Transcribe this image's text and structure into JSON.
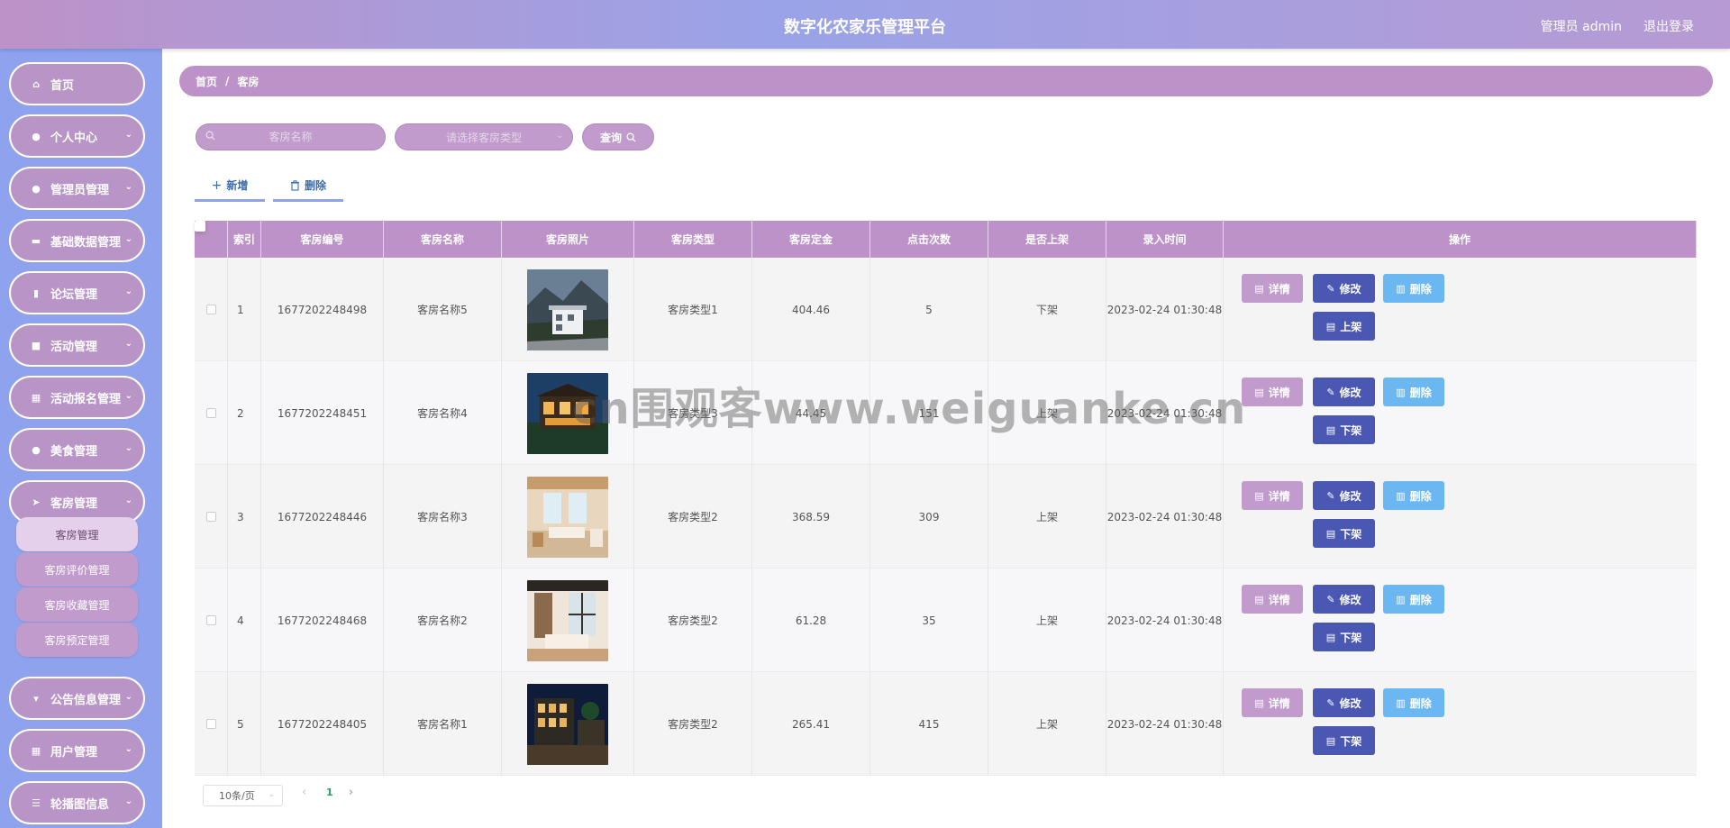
{
  "app": {
    "title": "数字化农家乐管理平台",
    "user_label": "管理员 admin",
    "logout_label": "退出登录"
  },
  "sidebar": {
    "items": [
      {
        "label": "首页",
        "icon": "home-icon",
        "glyph": "⌂",
        "has_children": false
      },
      {
        "label": "个人中心",
        "icon": "user-icon",
        "glyph": "●",
        "has_children": true
      },
      {
        "label": "管理员管理",
        "icon": "admin-icon",
        "glyph": "●",
        "has_children": true
      },
      {
        "label": "基础数据管理",
        "icon": "monitor-icon",
        "glyph": "▬",
        "has_children": true
      },
      {
        "label": "论坛管理",
        "icon": "thumb-icon",
        "glyph": "▮",
        "has_children": true
      },
      {
        "label": "活动管理",
        "icon": "briefcase-icon",
        "glyph": "■",
        "has_children": true
      },
      {
        "label": "活动报名管理",
        "icon": "grid-icon",
        "glyph": "▦",
        "has_children": true
      },
      {
        "label": "美食管理",
        "icon": "user-icon",
        "glyph": "●",
        "has_children": true
      },
      {
        "label": "客房管理",
        "icon": "send-icon",
        "glyph": "➤",
        "has_children": true
      },
      {
        "label": "公告信息管理",
        "icon": "cup-icon",
        "glyph": "▾",
        "has_children": true
      },
      {
        "label": "用户管理",
        "icon": "grid-icon",
        "glyph": "▦",
        "has_children": true
      },
      {
        "label": "轮播图信息",
        "icon": "sliders-icon",
        "glyph": "☰",
        "has_children": true
      }
    ],
    "submenu": [
      {
        "label": "客房管理",
        "active": true
      },
      {
        "label": "客房评价管理",
        "active": false
      },
      {
        "label": "客房收藏管理",
        "active": false
      },
      {
        "label": "客房预定管理",
        "active": false
      }
    ]
  },
  "breadcrumb": {
    "home": "首页",
    "separator": "/",
    "current": "客房"
  },
  "search": {
    "name_placeholder": "客房名称",
    "type_placeholder": "请选择客房类型",
    "query_label": "查询"
  },
  "toolbar": {
    "add_label": "新增",
    "delete_label": "删除"
  },
  "table": {
    "headers": [
      "索引",
      "客房编号",
      "客房名称",
      "客房照片",
      "客房类型",
      "客房定金",
      "点击次数",
      "是否上架",
      "录入时间",
      "操作"
    ],
    "rows": [
      {
        "index": "1",
        "code": "1677202248498",
        "name": "客房名称5",
        "photo": "room-photo-1",
        "type": "客房类型1",
        "deposit": "404.46",
        "clicks": "5",
        "listed": "下架",
        "time": "2023-02-24 01:30:48",
        "toggle": "上架"
      },
      {
        "index": "2",
        "code": "1677202248451",
        "name": "客房名称4",
        "photo": "room-photo-2",
        "type": "客房类型3",
        "deposit": "44.45",
        "clicks": "151",
        "listed": "上架",
        "time": "2023-02-24 01:30:48",
        "toggle": "下架"
      },
      {
        "index": "3",
        "code": "1677202248446",
        "name": "客房名称3",
        "photo": "room-photo-3",
        "type": "客房类型2",
        "deposit": "368.59",
        "clicks": "309",
        "listed": "上架",
        "time": "2023-02-24 01:30:48",
        "toggle": "下架"
      },
      {
        "index": "4",
        "code": "1677202248468",
        "name": "客房名称2",
        "photo": "room-photo-4",
        "type": "客房类型2",
        "deposit": "61.28",
        "clicks": "35",
        "listed": "上架",
        "time": "2023-02-24 01:30:48",
        "toggle": "下架"
      },
      {
        "index": "5",
        "code": "1677202248405",
        "name": "客房名称1",
        "photo": "room-photo-5",
        "type": "客房类型2",
        "deposit": "265.41",
        "clicks": "415",
        "listed": "上架",
        "time": "2023-02-24 01:30:48",
        "toggle": "下架"
      }
    ],
    "actions": {
      "detail": "详情",
      "edit": "修改",
      "remove": "删除"
    }
  },
  "pagination": {
    "page_size": "10条/页",
    "current_page": "1"
  },
  "watermark": "cn围观客www.weiguanke.cn",
  "colors": {
    "header_gradient_start": "#bd92c8",
    "header_gradient_mid": "#9aa3e8",
    "sidebar_bg": "#8fa2ee",
    "accent_purple": "#bc92c8",
    "edit_blue": "#4a57b3",
    "delete_light_blue": "#6bb7f2",
    "page_active_green": "#2e9e63"
  }
}
